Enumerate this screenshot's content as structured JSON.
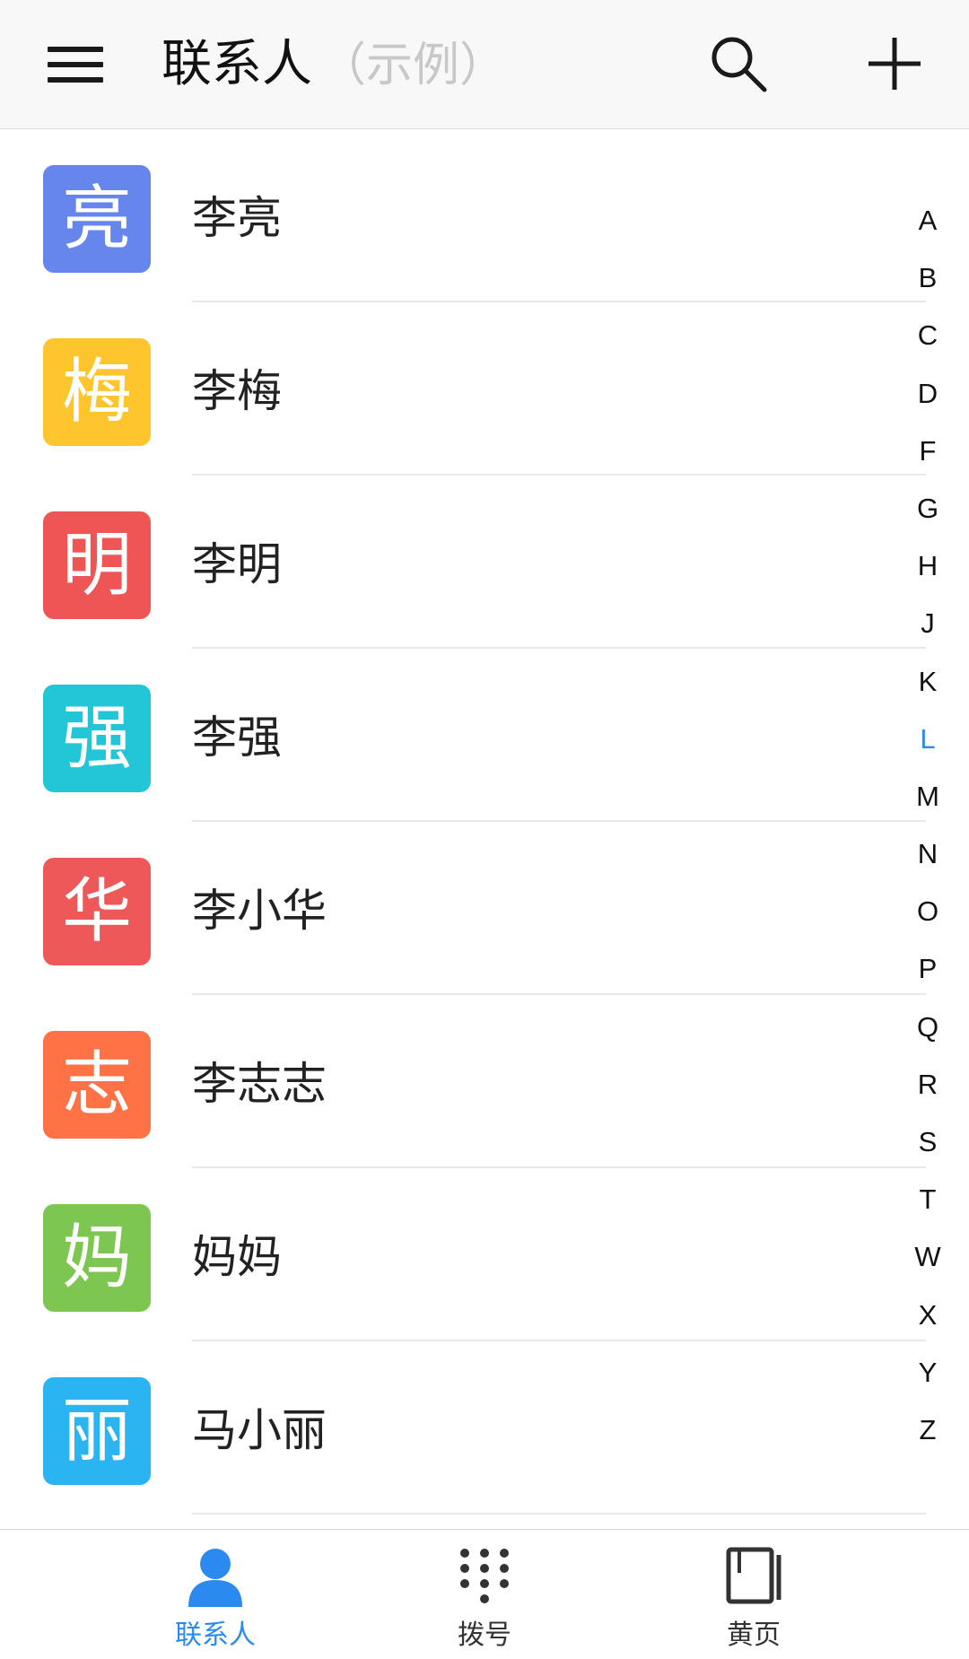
{
  "header": {
    "title": "联系人",
    "subtitle": "（示例）",
    "menu_icon": "hamburger-menu-icon",
    "search_icon": "search-icon",
    "add_icon": "plus-icon"
  },
  "contacts": [
    {
      "initial": "亮",
      "name": "李亮",
      "color": "#6686EE"
    },
    {
      "initial": "梅",
      "name": "李梅",
      "color": "#FFC52E"
    },
    {
      "initial": "明",
      "name": "李明",
      "color": "#EF5555"
    },
    {
      "initial": "强",
      "name": "李强",
      "color": "#22C6D6"
    },
    {
      "initial": "华",
      "name": "李小华",
      "color": "#EF5858"
    },
    {
      "initial": "志",
      "name": "李志志",
      "color": "#FF7246"
    },
    {
      "initial": "妈",
      "name": "妈妈",
      "color": "#7DC651"
    },
    {
      "initial": "丽",
      "name": "马小丽",
      "color": "#2AB4F2"
    }
  ],
  "index_letters": [
    "A",
    "B",
    "C",
    "D",
    "F",
    "G",
    "H",
    "J",
    "K",
    "L",
    "M",
    "N",
    "O",
    "P",
    "Q",
    "R",
    "S",
    "T",
    "W",
    "X",
    "Y",
    "Z"
  ],
  "index_active": "L",
  "tabs": [
    {
      "label": "联系人",
      "icon": "person-icon",
      "active": true
    },
    {
      "label": "拨号",
      "icon": "dialpad-icon",
      "active": false
    },
    {
      "label": "黄页",
      "icon": "book-icon",
      "active": false
    }
  ],
  "colors": {
    "accent": "#2A8AF0",
    "title_text": "#111111",
    "subtitle_text": "#C8C8C8"
  }
}
